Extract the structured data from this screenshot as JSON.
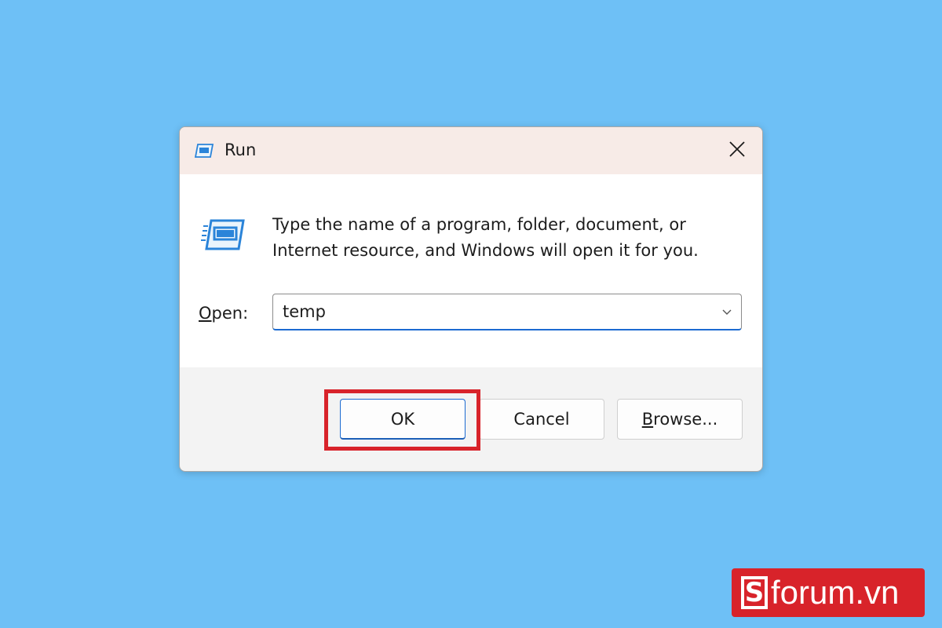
{
  "window": {
    "title": "Run",
    "title_icon": "run-app-icon",
    "close_icon": "close-icon"
  },
  "content": {
    "icon": "run-app-icon",
    "description": "Type the name of a program, folder, document, or Internet resource, and Windows will open it for you.",
    "open_label_accel": "O",
    "open_label_rest": "pen:",
    "open_value": "temp"
  },
  "buttons": {
    "ok": "OK",
    "cancel": "Cancel",
    "browse_accel": "B",
    "browse_rest": "rowse..."
  },
  "colors": {
    "background": "#6ec0f6",
    "accent": "#1c6bd1",
    "highlight": "#d8232a"
  },
  "watermark": {
    "letter": "S",
    "text": "forum.vn"
  }
}
